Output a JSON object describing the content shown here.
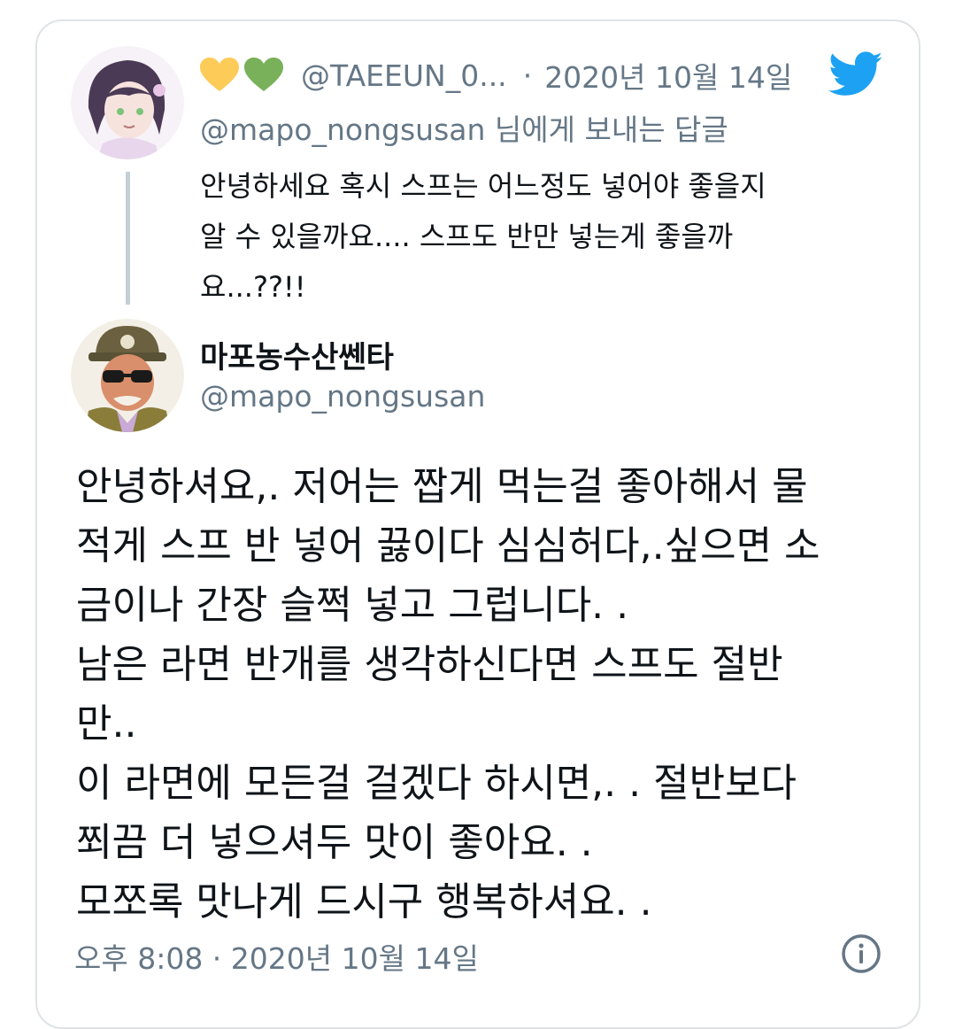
{
  "reply": {
    "emoji_icons": [
      "yellow-heart-icon",
      "green-heart-icon"
    ],
    "handle": "@TAEEUN_0...",
    "separator": "·",
    "date": "2020년 10월 14일",
    "replying_to_handle": "@mapo_nongsusan",
    "replying_to_suffix": " 님에게 보내는 답글",
    "text_lines": [
      "안녕하세요 혹시 스프는 어느정도 넣어야 좋을지",
      "알 수 있을까요....  스프도 반만 넣는게 좋을까",
      "요...??!!"
    ]
  },
  "tweet": {
    "author_name": "마포농수산쎈타",
    "author_handle": "@mapo_nongsusan",
    "body_lines": [
      "안녕하셔요,. 저어는 짭게 먹는걸 좋아해서 물",
      "적게 스프 반 넣어 끓이다 심심허다,.싶으면 소",
      "금이나 간장 슬쩍 넣고 그럽니다. .",
      "남은 라면 반개를 생각하신다면 스프도 절반",
      "만..",
      "이 라면에 모든걸 걸겠다 하시면,. . 절반보다",
      "쬐끔 더 넣으셔두 맛이 좋아요. .",
      "모쪼록 맛나게 드시구 행복하셔요. ."
    ],
    "timestamp": "오후 8:08 · 2020년 10월 14일"
  },
  "colors": {
    "twitter_blue": "#1da1f2",
    "secondary_text": "#657786",
    "border": "#dfe3e6",
    "thread_line": "#c4cfd6"
  }
}
